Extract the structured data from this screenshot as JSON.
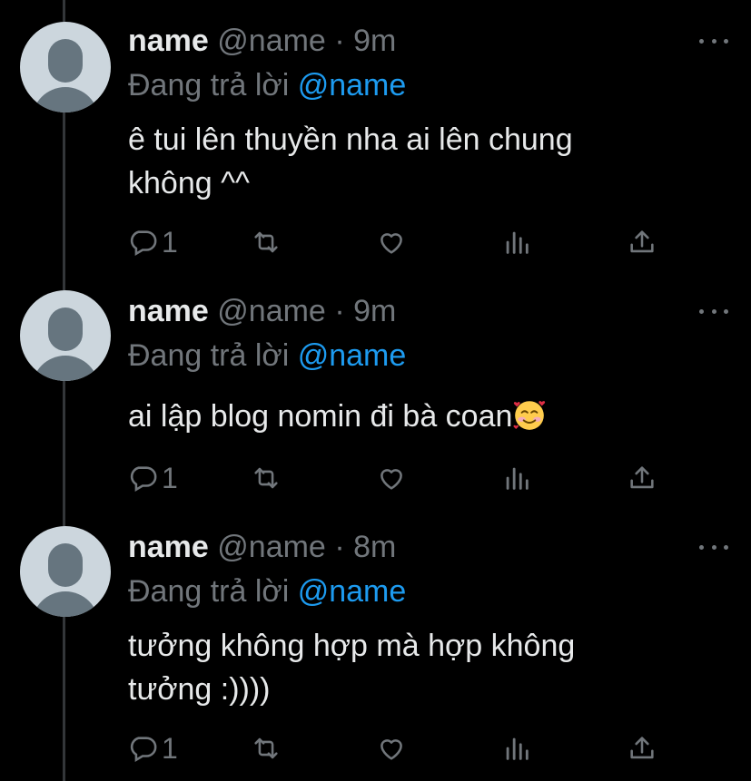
{
  "tweets": [
    {
      "display_name": "name",
      "handle": "@name",
      "separator": "·",
      "time": "9m",
      "replying_prefix": "Đang trả lời",
      "replying_to": "@name",
      "text": "ê tui lên thuyền nha ai lên chung\nkhông ^^",
      "emoji": "",
      "reply_count": "1"
    },
    {
      "display_name": "name",
      "handle": "@name",
      "separator": "·",
      "time": "9m",
      "replying_prefix": "Đang trả lời",
      "replying_to": "@name",
      "text": "ai lập blog nomin đi bà coan",
      "emoji": "smiling-face-with-hearts",
      "reply_count": "1"
    },
    {
      "display_name": "name",
      "handle": "@name",
      "separator": "·",
      "time": "8m",
      "replying_prefix": "Đang trả lời",
      "replying_to": "@name",
      "text": "tưởng không hợp mà hợp không\ntưởng :))))",
      "emoji": "",
      "reply_count": "1"
    }
  ],
  "colors": {
    "background": "#000000",
    "text": "#e7e9ea",
    "secondary": "#71767b",
    "mention": "#1d9bf0",
    "avatar_bg": "#ccd6dd",
    "avatar_fg": "#66757f",
    "thread_line": "#333639"
  }
}
